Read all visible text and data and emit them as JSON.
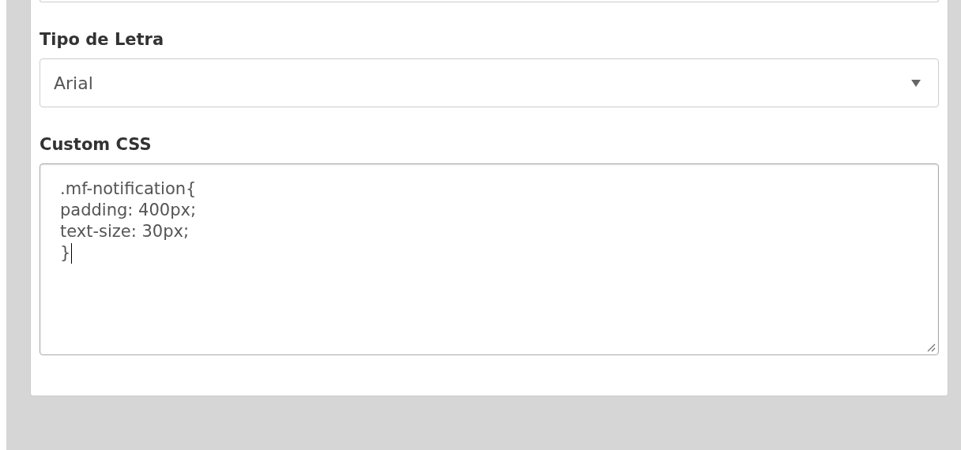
{
  "fields": [
    {
      "kind": "select",
      "label": "Tipo de Letra",
      "value": "Arial"
    },
    {
      "kind": "textarea",
      "label": "Custom CSS",
      "lines": [
        ".mf-notification{",
        "padding: 400px;",
        "text-size: 30px;",
        "}"
      ],
      "caret_visible": true
    }
  ]
}
